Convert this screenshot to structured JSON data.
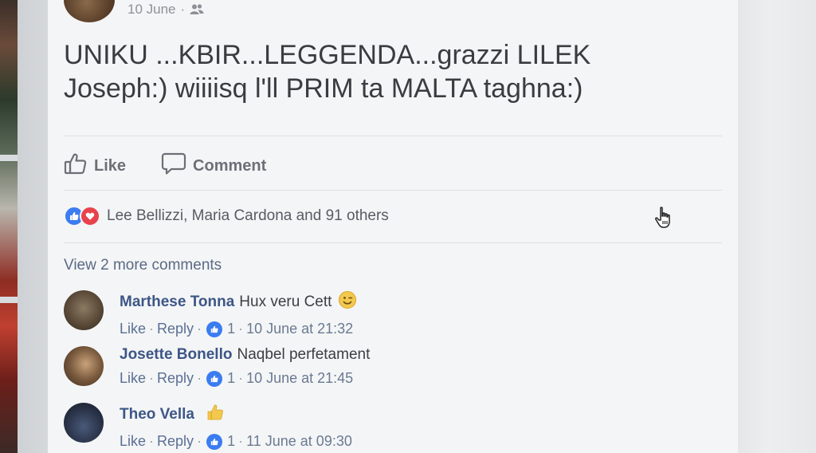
{
  "post": {
    "date": "10 June",
    "meta_separator": "·",
    "audience_icon": "friends-icon",
    "text_line1": "UNIKU ...KBIR...LEGGENDA...grazzi LILEK",
    "text_line2": "Joseph:) wiiiisq l'll PRIM ta MALTA taghna:)"
  },
  "actions": {
    "like_label": "Like",
    "comment_label": "Comment"
  },
  "reactions": {
    "summary": "Lee Bellizzi, Maria Cardona and 91 others",
    "types": [
      "like",
      "love"
    ]
  },
  "comments_section": {
    "view_more_label": "View 2 more comments"
  },
  "comments": [
    {
      "author": "Marthese Tonna",
      "text": "Hux veru Cett",
      "emoji": "wink-emoji",
      "like_label": "Like",
      "reply_label": "Reply",
      "like_count": "1",
      "timestamp": "10 June at 21:32"
    },
    {
      "author": "Josette Bonello",
      "text": "Naqbel perfetament",
      "emoji": "",
      "like_label": "Like",
      "reply_label": "Reply",
      "like_count": "1",
      "timestamp": "10 June at 21:45"
    },
    {
      "author": "Theo Vella",
      "text": "",
      "emoji": "thumbs-up-emoji",
      "like_label": "Like",
      "reply_label": "Reply",
      "like_count": "1",
      "timestamp": "11 June at 09:30"
    }
  ],
  "colors": {
    "link_blue": "#3d5687",
    "like_blue": "#3b7cf0",
    "love_red": "#e8434d",
    "text_dark": "#3a3c40",
    "muted": "#6b7077"
  }
}
